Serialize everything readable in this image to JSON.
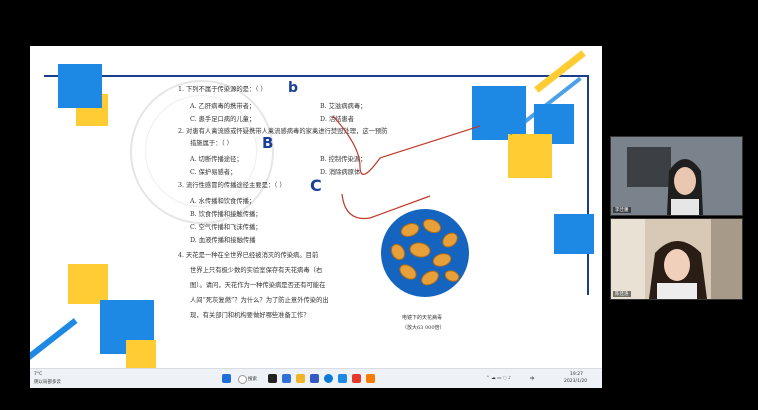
{
  "slide": {
    "questions": [
      {
        "text": "1. 下列不属于传染源的是：（  ）",
        "options": [
          "A. 乙肝病毒的携带者；",
          "B. 艾滋病病毒；",
          "C. 患手足口病的儿童；",
          "D. 活结患者"
        ]
      },
      {
        "text": "2. 对患有人禽流感或怀疑携带人禽流感病毒的家禽进行焚毁处理，这一预防",
        "text2": "措施属于：（  ）",
        "options": [
          "A. 切断传播途径；",
          "B. 控制传染源；",
          "C. 保护易感者；",
          "D. 消除病原体"
        ]
      },
      {
        "text": "3. 流行性感冒的传播途径主要是：（  ）",
        "options": [
          "A. 水传播和饮食传播；",
          "B. 饮食传播和接触传播；",
          "C. 空气传播和飞沫传播；",
          "D. 血液传播和接触传播"
        ]
      }
    ],
    "q4_lines": [
      "4. 天花是一种在全世界已经被消灭的传染病。目前",
      "世界上只有极少数的实验室保存有天花病毒（右",
      "图）。请问，天花作为一种传染病是否还有可能在",
      "人间“死灰复燃”？为什么？为了防止意外传染的出",
      "现，有关部门和机构要做好哪些准备工作？"
    ],
    "virus_caption_1": "电镜下的天花病毒",
    "virus_caption_2": "（放大63 000倍）",
    "handwriting": {
      "a1": "b",
      "a2": "B",
      "a3": "C"
    }
  },
  "taskbar": {
    "weather_temp": "7°C",
    "weather_desc": "阴以局部多云",
    "search_label": "搜索",
    "time": "19:27",
    "date": "2023/1/20",
    "lang": "中"
  },
  "participants": [
    {
      "name": "李佳蕙"
    },
    {
      "name": "陈佳洛"
    }
  ],
  "colors": {
    "accent_blue": "#1e88e5",
    "accent_yellow": "#ffcc33",
    "frame_blue": "#1a3e8a",
    "ink": "#1a3f99",
    "pen_red": "#c0392b"
  }
}
